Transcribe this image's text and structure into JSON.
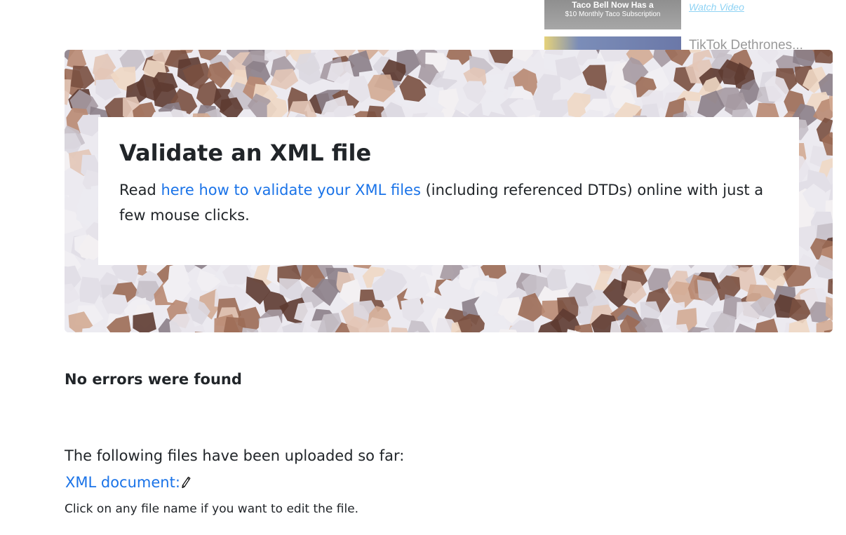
{
  "ad": {
    "item1": {
      "thumb_line1": "Taco Bell Now Has a",
      "thumb_line2": "$10 Monthly Taco Subscription",
      "link": "Watch Video"
    },
    "item2": {
      "title": "TikTok Dethrones..."
    }
  },
  "hero": {
    "title": "Validate an XML file",
    "text_before": "Read ",
    "link_text": "here how to validate your XML files",
    "text_after": " (including referenced DTDs) online with just a few mouse clicks."
  },
  "result": {
    "message": "No errors were found"
  },
  "files": {
    "intro": "The following files have been uploaded so far:",
    "items": [
      {
        "label": "XML document:"
      }
    ],
    "hint": "Click on any file name if you want to edit the file."
  },
  "colors": {
    "link": "#1a73e8",
    "text": "#212529",
    "ad_link": "#8fd3f4"
  }
}
